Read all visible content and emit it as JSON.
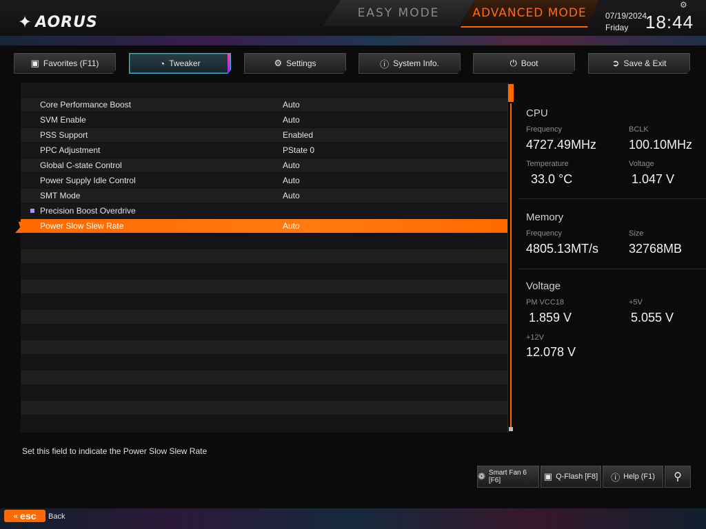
{
  "header": {
    "logo_text": "AORUS",
    "easy_mode": "EASY MODE",
    "advanced_mode": "ADVANCED MODE",
    "date": "07/19/2024",
    "day": "Friday",
    "time": "18:44"
  },
  "tabs": [
    {
      "label": "Favorites (F11)",
      "icon": "favorites-icon"
    },
    {
      "label": "Tweaker",
      "icon": "speedometer-icon",
      "active": true
    },
    {
      "label": "Settings",
      "icon": "gear-icon"
    },
    {
      "label": "System Info.",
      "icon": "info-icon"
    },
    {
      "label": "Boot",
      "icon": "power-icon"
    },
    {
      "label": "Save & Exit",
      "icon": "exit-icon"
    }
  ],
  "settings": [
    {
      "name": "Core Performance Boost",
      "value": "Auto"
    },
    {
      "name": "SVM Enable",
      "value": "Auto"
    },
    {
      "name": "PSS Support",
      "value": "Enabled"
    },
    {
      "name": "PPC Adjustment",
      "value": "PState 0"
    },
    {
      "name": "Global C-state Control",
      "value": "Auto"
    },
    {
      "name": "Power Supply Idle Control",
      "value": "Auto"
    },
    {
      "name": "SMT Mode",
      "value": "Auto"
    },
    {
      "name": "Precision Boost Overdrive",
      "value": "",
      "submenu": true
    },
    {
      "name": "Power Slow Slew Rate",
      "value": "Auto",
      "selected": true
    }
  ],
  "info": {
    "cpu": {
      "title": "CPU",
      "frequency_label": "Frequency",
      "frequency": "4727.49MHz",
      "bclk_label": "BCLK",
      "bclk": "100.10MHz",
      "temperature_label": "Temperature",
      "temperature": "33.0 °C",
      "voltage_label": "Voltage",
      "voltage": "1.047 V"
    },
    "memory": {
      "title": "Memory",
      "frequency_label": "Frequency",
      "frequency": "4805.13MT/s",
      "size_label": "Size",
      "size": "32768MB"
    },
    "voltage": {
      "title": "Voltage",
      "pm_vcc18_label": "PM VCC18",
      "pm_vcc18": "1.859 V",
      "p5v_label": "+5V",
      "p5v": "5.055 V",
      "p12v_label": "+12V",
      "p12v": "12.078 V"
    }
  },
  "help_text": "Set this field to indicate the Power Slow Slew Rate",
  "bottom_buttons": {
    "smart_fan": "Smart Fan 6 [F6]",
    "qflash": "Q-Flash [F8]",
    "help": "Help (F1)"
  },
  "footer": {
    "esc_label": "esc",
    "back_label": "Back"
  },
  "colors": {
    "accent": "#ff6a00",
    "active_tab": "#3fb7c6",
    "submenu_bullet": "#b48cff"
  }
}
